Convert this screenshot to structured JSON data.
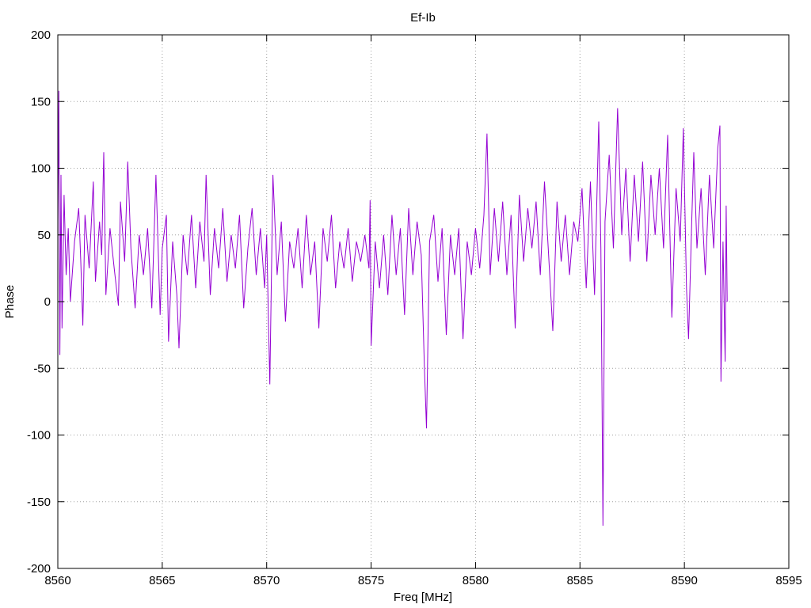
{
  "chart_data": {
    "type": "line",
    "title": "Ef-Ib",
    "xlabel": "Freq [MHz]",
    "ylabel": "Phase",
    "xlim": [
      8560,
      8595
    ],
    "ylim": [
      -200,
      200
    ],
    "xticks": [
      8560,
      8565,
      8570,
      8575,
      8580,
      8585,
      8590,
      8595
    ],
    "yticks": [
      -200,
      -150,
      -100,
      -50,
      0,
      50,
      100,
      150,
      200
    ],
    "grid": true,
    "line_color": "#9400d3",
    "series": [
      {
        "x_start": 8560,
        "x_end": 8592,
        "points": [
          [
            8560.0,
            60
          ],
          [
            8560.05,
            158
          ],
          [
            8560.1,
            -40
          ],
          [
            8560.15,
            95
          ],
          [
            8560.2,
            -20
          ],
          [
            8560.3,
            80
          ],
          [
            8560.4,
            20
          ],
          [
            8560.5,
            55
          ],
          [
            8560.6,
            0
          ],
          [
            8560.8,
            45
          ],
          [
            8561.0,
            70
          ],
          [
            8561.1,
            30
          ],
          [
            8561.2,
            -18
          ],
          [
            8561.3,
            65
          ],
          [
            8561.5,
            25
          ],
          [
            8561.7,
            90
          ],
          [
            8561.8,
            15
          ],
          [
            8562.0,
            60
          ],
          [
            8562.1,
            35
          ],
          [
            8562.2,
            112
          ],
          [
            8562.3,
            5
          ],
          [
            8562.5,
            55
          ],
          [
            8562.7,
            25
          ],
          [
            8562.9,
            -3
          ],
          [
            8563.0,
            75
          ],
          [
            8563.2,
            30
          ],
          [
            8563.35,
            105
          ],
          [
            8563.5,
            40
          ],
          [
            8563.7,
            -5
          ],
          [
            8563.9,
            50
          ],
          [
            8564.1,
            20
          ],
          [
            8564.3,
            55
          ],
          [
            8564.5,
            -5
          ],
          [
            8564.7,
            95
          ],
          [
            8564.9,
            -10
          ],
          [
            8565.0,
            40
          ],
          [
            8565.2,
            65
          ],
          [
            8565.3,
            -30
          ],
          [
            8565.5,
            45
          ],
          [
            8565.7,
            5
          ],
          [
            8565.8,
            -35
          ],
          [
            8566.0,
            50
          ],
          [
            8566.2,
            20
          ],
          [
            8566.4,
            65
          ],
          [
            8566.6,
            10
          ],
          [
            8566.8,
            60
          ],
          [
            8567.0,
            30
          ],
          [
            8567.1,
            95
          ],
          [
            8567.3,
            5
          ],
          [
            8567.5,
            55
          ],
          [
            8567.7,
            25
          ],
          [
            8567.9,
            70
          ],
          [
            8568.1,
            15
          ],
          [
            8568.3,
            50
          ],
          [
            8568.5,
            25
          ],
          [
            8568.7,
            65
          ],
          [
            8568.9,
            -5
          ],
          [
            8569.1,
            40
          ],
          [
            8569.3,
            70
          ],
          [
            8569.5,
            20
          ],
          [
            8569.7,
            55
          ],
          [
            8569.9,
            10
          ],
          [
            8570.0,
            50
          ],
          [
            8570.15,
            -62
          ],
          [
            8570.3,
            95
          ],
          [
            8570.5,
            20
          ],
          [
            8570.7,
            60
          ],
          [
            8570.9,
            -15
          ],
          [
            8571.1,
            45
          ],
          [
            8571.3,
            25
          ],
          [
            8571.5,
            55
          ],
          [
            8571.7,
            10
          ],
          [
            8571.9,
            65
          ],
          [
            8572.1,
            20
          ],
          [
            8572.3,
            45
          ],
          [
            8572.5,
            -20
          ],
          [
            8572.7,
            55
          ],
          [
            8572.9,
            30
          ],
          [
            8573.1,
            65
          ],
          [
            8573.3,
            10
          ],
          [
            8573.5,
            45
          ],
          [
            8573.7,
            25
          ],
          [
            8573.9,
            55
          ],
          [
            8574.1,
            15
          ],
          [
            8574.3,
            45
          ],
          [
            8574.5,
            30
          ],
          [
            8574.7,
            50
          ],
          [
            8574.9,
            25
          ],
          [
            8574.95,
            76
          ],
          [
            8575.0,
            -33
          ],
          [
            8575.2,
            45
          ],
          [
            8575.4,
            10
          ],
          [
            8575.6,
            50
          ],
          [
            8575.8,
            5
          ],
          [
            8576.0,
            65
          ],
          [
            8576.2,
            20
          ],
          [
            8576.4,
            55
          ],
          [
            8576.6,
            -10
          ],
          [
            8576.8,
            70
          ],
          [
            8577.0,
            20
          ],
          [
            8577.2,
            60
          ],
          [
            8577.4,
            35
          ],
          [
            8577.55,
            -48
          ],
          [
            8577.65,
            -95
          ],
          [
            8577.8,
            45
          ],
          [
            8578.0,
            65
          ],
          [
            8578.2,
            15
          ],
          [
            8578.4,
            55
          ],
          [
            8578.6,
            -25
          ],
          [
            8578.8,
            50
          ],
          [
            8579.0,
            20
          ],
          [
            8579.2,
            55
          ],
          [
            8579.4,
            -28
          ],
          [
            8579.6,
            45
          ],
          [
            8579.8,
            20
          ],
          [
            8580.0,
            55
          ],
          [
            8580.2,
            25
          ],
          [
            8580.4,
            65
          ],
          [
            8580.55,
            126
          ],
          [
            8580.7,
            20
          ],
          [
            8580.9,
            70
          ],
          [
            8581.1,
            30
          ],
          [
            8581.3,
            75
          ],
          [
            8581.5,
            20
          ],
          [
            8581.7,
            65
          ],
          [
            8581.9,
            -20
          ],
          [
            8582.1,
            80
          ],
          [
            8582.3,
            30
          ],
          [
            8582.5,
            70
          ],
          [
            8582.7,
            40
          ],
          [
            8582.9,
            75
          ],
          [
            8583.1,
            20
          ],
          [
            8583.3,
            90
          ],
          [
            8583.5,
            35
          ],
          [
            8583.7,
            -22
          ],
          [
            8583.9,
            75
          ],
          [
            8584.1,
            30
          ],
          [
            8584.3,
            65
          ],
          [
            8584.5,
            20
          ],
          [
            8584.7,
            60
          ],
          [
            8584.9,
            45
          ],
          [
            8585.1,
            85
          ],
          [
            8585.3,
            10
          ],
          [
            8585.5,
            90
          ],
          [
            8585.7,
            5
          ],
          [
            8585.9,
            135
          ],
          [
            8586.0,
            40
          ],
          [
            8586.05,
            -60
          ],
          [
            8586.1,
            -168
          ],
          [
            8586.2,
            60
          ],
          [
            8586.4,
            110
          ],
          [
            8586.6,
            40
          ],
          [
            8586.8,
            145
          ],
          [
            8587.0,
            50
          ],
          [
            8587.2,
            100
          ],
          [
            8587.4,
            30
          ],
          [
            8587.6,
            95
          ],
          [
            8587.8,
            45
          ],
          [
            8588.0,
            105
          ],
          [
            8588.2,
            30
          ],
          [
            8588.4,
            95
          ],
          [
            8588.6,
            50
          ],
          [
            8588.8,
            100
          ],
          [
            8589.0,
            40
          ],
          [
            8589.2,
            125
          ],
          [
            8589.4,
            -12
          ],
          [
            8589.6,
            85
          ],
          [
            8589.8,
            45
          ],
          [
            8589.95,
            130
          ],
          [
            8590.1,
            10
          ],
          [
            8590.2,
            -28
          ],
          [
            8590.35,
            60
          ],
          [
            8590.45,
            112
          ],
          [
            8590.6,
            40
          ],
          [
            8590.8,
            85
          ],
          [
            8591.0,
            20
          ],
          [
            8591.2,
            95
          ],
          [
            8591.4,
            40
          ],
          [
            8591.6,
            115
          ],
          [
            8591.7,
            132
          ],
          [
            8591.75,
            -60
          ],
          [
            8591.85,
            45
          ],
          [
            8591.95,
            -45
          ],
          [
            8592.0,
            72
          ],
          [
            8592.05,
            0
          ]
        ]
      }
    ]
  }
}
